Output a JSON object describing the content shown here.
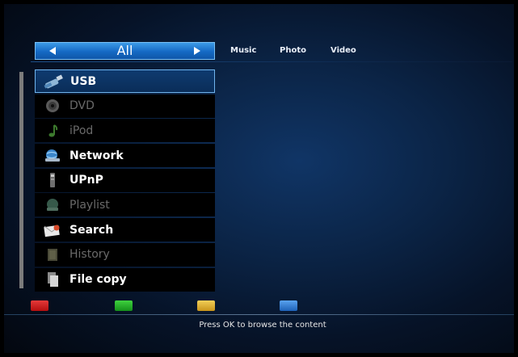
{
  "category_selector": {
    "current": "All",
    "prev_label": "◄",
    "next_label": "►"
  },
  "tabs": [
    {
      "label": "Music"
    },
    {
      "label": "Photo"
    },
    {
      "label": "Video"
    }
  ],
  "sources": [
    {
      "label": "USB",
      "icon": "usb-icon",
      "enabled": true,
      "selected": true
    },
    {
      "label": "DVD",
      "icon": "disc-icon",
      "enabled": false,
      "selected": false
    },
    {
      "label": "iPod",
      "icon": "music-note-icon",
      "enabled": false,
      "selected": false
    },
    {
      "label": "Network",
      "icon": "network-icon",
      "enabled": true,
      "selected": false
    },
    {
      "label": "UPnP",
      "icon": "upnp-icon",
      "enabled": true,
      "selected": false
    },
    {
      "label": "Playlist",
      "icon": "playlist-icon",
      "enabled": false,
      "selected": false
    },
    {
      "label": "Search",
      "icon": "search-icon",
      "enabled": true,
      "selected": false
    },
    {
      "label": "History",
      "icon": "history-icon",
      "enabled": false,
      "selected": false
    },
    {
      "label": "File copy",
      "icon": "file-copy-icon",
      "enabled": true,
      "selected": false
    }
  ],
  "color_keys": [
    {
      "name": "red",
      "color": "#d01818"
    },
    {
      "name": "green",
      "color": "#1fae1f"
    },
    {
      "name": "yellow",
      "color": "#e5b52a"
    },
    {
      "name": "blue",
      "color": "#2f7fd9"
    }
  ],
  "hint": "Press OK to browse the content"
}
